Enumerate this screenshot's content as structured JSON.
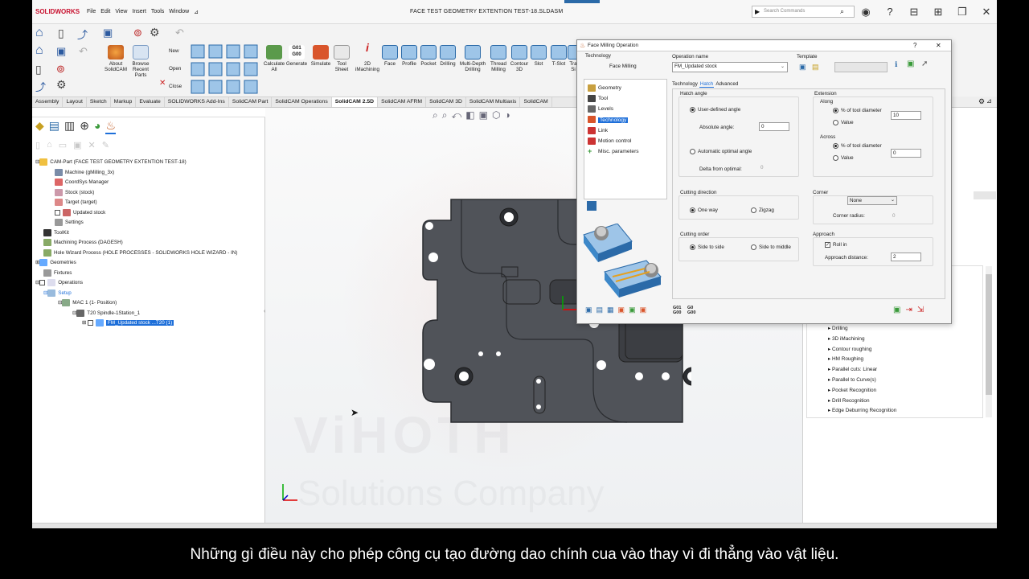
{
  "app": {
    "logo": "SOLIDWORKS",
    "title": "FACE TEST GEOMETRY EXTENTION TEST-18.SLDASM",
    "search_placeholder": "Search Commands"
  },
  "menu": [
    "File",
    "Edit",
    "View",
    "Insert",
    "Tools",
    "Window"
  ],
  "ribbon": {
    "left": [
      {
        "label": "About\nSolidCAM"
      },
      {
        "label": "Browse\nRecent\nParts"
      },
      {
        "label": "New"
      },
      {
        "label": "Open"
      },
      {
        "label": "Close"
      }
    ],
    "right": [
      {
        "label": "Calculate\nAll"
      },
      {
        "label": "Generate"
      },
      {
        "label": "Simulate"
      },
      {
        "label": "Tool\nSheet"
      },
      {
        "label": "2D\niMachining"
      },
      {
        "label": "Face"
      },
      {
        "label": "Profile"
      },
      {
        "label": "Pocket"
      },
      {
        "label": "Drilling"
      },
      {
        "label": "Multi-Depth\nDrilling"
      },
      {
        "label": "Thread\nMilling"
      },
      {
        "label": "Contour\n3D"
      },
      {
        "label": "Slot"
      },
      {
        "label": "T-Slot"
      },
      {
        "label": "Tra\nSi"
      }
    ],
    "g01": "G01\nG00"
  },
  "tabs": [
    "Assembly",
    "Layout",
    "Sketch",
    "Markup",
    "Evaluate",
    "SOLIDWORKS Add-Ins",
    "SolidCAM Part",
    "SolidCAM Operations",
    "SolidCAM 2.5D",
    "SolidCAM AFRM",
    "SolidCAM 3D",
    "SolidCAM Multiaxis",
    "SolidCAM"
  ],
  "active_tab": "SolidCAM 2.5D",
  "tree": [
    {
      "label": "CAM-Part (FACE TEST GEOMETRY EXTENTION TEST-18)",
      "indent": 0
    },
    {
      "label": "Machine (gMilling_3x)",
      "indent": 1
    },
    {
      "label": "CoordSys Manager",
      "indent": 1
    },
    {
      "label": "Stock (stock)",
      "indent": 1
    },
    {
      "label": "Target (target)",
      "indent": 1
    },
    {
      "label": "Updated stock",
      "indent": 1
    },
    {
      "label": "Settings",
      "indent": 1
    },
    {
      "label": "ToolKit",
      "indent": 0
    },
    {
      "label": "Machining Process (DAGESH)",
      "indent": 0
    },
    {
      "label": "Hole Wizard Process (HOLE PROCESSES - SOLIDWORKS HOLE WIZARD - IN)",
      "indent": 0
    },
    {
      "label": "Geometries",
      "indent": 0
    },
    {
      "label": "Fixtures",
      "indent": 0
    },
    {
      "label": "Operations",
      "indent": 0
    },
    {
      "label": "Setup",
      "indent": 1
    },
    {
      "label": "MAC 1 (1- Position)",
      "indent": 2
    },
    {
      "label": "T20 Spindle-1Station_1",
      "indent": 3
    },
    {
      "label": "FM_Updated stock ...T20 (1)",
      "indent": 4
    }
  ],
  "dialog": {
    "title": "Face Milling Operation",
    "technology_label": "Technology",
    "technology_value": "Face Milling",
    "operation_name_label": "Operation name",
    "operation_name": "FM_Updated stock",
    "template_label": "Template",
    "nav": [
      "Geometry",
      "Tool",
      "Levels",
      "Technology",
      "Link",
      "Motion control",
      "Misc. parameters"
    ],
    "nav_selected": "Technology",
    "subtabs": [
      "Technology",
      "Hatch",
      "Advanced"
    ],
    "hatch_angle_label": "Hatch angle",
    "user_defined_angle": "User-defined angle",
    "absolute_angle_label": "Absolute angle:",
    "absolute_angle": "0",
    "auto_optimal_angle": "Automatic optimal angle",
    "delta_label": "Delta from optimal:",
    "delta": "0",
    "extension_label": "Extension",
    "along_label": "Along",
    "pct_tool_diameter": "% of tool diameter",
    "value_label": "Value",
    "along_value": "10",
    "across_label": "Across",
    "across_value": "0",
    "cutting_direction_label": "Cutting direction",
    "one_way": "One way",
    "zigzag": "Zigzag",
    "corner_label": "Corner",
    "corner_value": "None",
    "corner_radius_label": "Corner radius:",
    "corner_radius": "0",
    "cutting_order_label": "Cutting order",
    "side_to_side": "Side to side",
    "side_to_middle": "Side to middle",
    "approach_label": "Approach",
    "roll_in": "Roll in",
    "approach_distance_label": "Approach distance:",
    "approach_distance": "2",
    "g01": "G01\nG00",
    "g0": "G0\nG00"
  },
  "right_list": [
    "Drilling",
    "3D iMachining",
    "Contour roughing",
    "HM Roughing",
    "Parallel cuts: Linear",
    "Parallel to Curve(s)",
    "Pocket Recognition",
    "Drill Recognition",
    "Edge Deburring Recognition"
  ],
  "watermark": {
    "line1": "ViHOTH",
    "line2": "Solutions Company"
  },
  "subtitle": "Những gì điều này cho phép công cụ tạo đường dao chính cua vào thay vì đi thẳng vào vật liệu.",
  "colors": {
    "selection": "#1e6fd9",
    "part": "#505359",
    "accent": "#c8102e"
  }
}
